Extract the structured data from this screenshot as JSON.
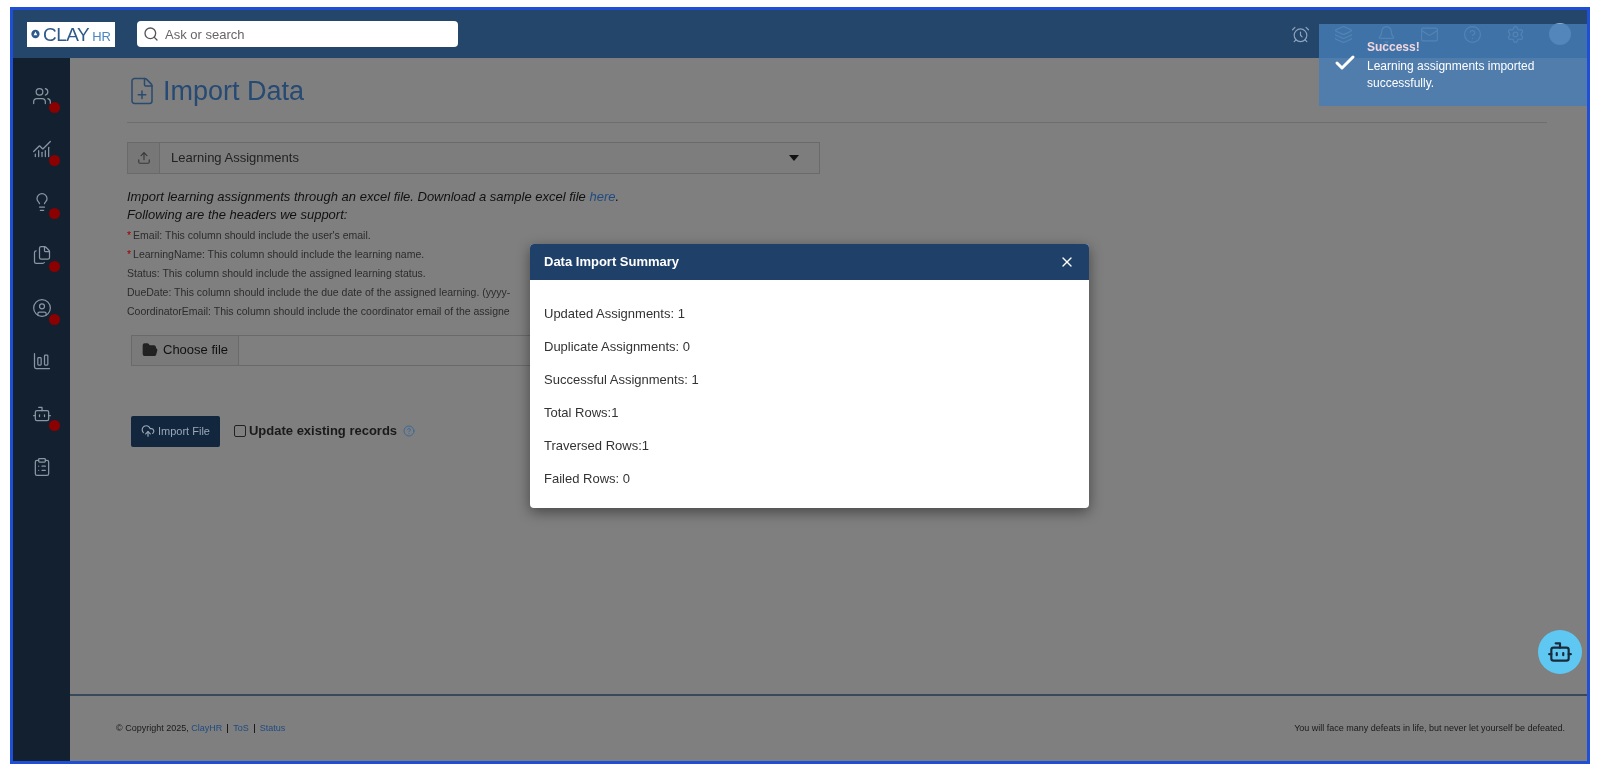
{
  "header": {
    "logo": {
      "main": "CLAY",
      "suffix": "HR"
    },
    "search": {
      "placeholder": "Ask or search"
    },
    "icons": [
      {
        "kind": "alarm"
      },
      {
        "kind": "layers"
      },
      {
        "kind": "bell"
      },
      {
        "kind": "mail"
      },
      {
        "kind": "help"
      },
      {
        "kind": "settings"
      }
    ]
  },
  "sidebar": {
    "items": [
      {
        "kind": "people",
        "alert": true
      },
      {
        "kind": "growth",
        "alert": true
      },
      {
        "kind": "idea",
        "alert": true
      },
      {
        "kind": "documents",
        "alert": true
      },
      {
        "kind": "profile",
        "alert": true
      },
      {
        "kind": "report",
        "alert": false
      },
      {
        "kind": "bot",
        "alert": true
      },
      {
        "kind": "clipboard",
        "alert": false
      }
    ]
  },
  "page": {
    "title": "Import Data",
    "type_select": {
      "value": "Learning Assignments"
    },
    "intro": "Import learning assignments through an excel file. Download a sample excel file ",
    "intro_link": "here",
    "intro_end": ".",
    "headers_title": "Following are the headers we support:",
    "headers": [
      {
        "marker": "*",
        "text": "Email: This column should include the user's email."
      },
      {
        "marker": "*",
        "text": "LearningName: This column should include the learning name."
      },
      {
        "text": "Status: This column should include the assigned learning status."
      },
      {
        "text": "DueDate: This column should include the due date of the assigned learning. (yyyy-"
      },
      {
        "text": "CoordinatorEmail: This column should include the coordinator email of the assigne"
      }
    ],
    "file_button": "Choose file",
    "import_button": "Import File",
    "update_existing": {
      "label": "Update existing records",
      "checked": false
    }
  },
  "modal": {
    "title": "Data Import Summary",
    "lines": [
      "Updated Assignments: 1",
      "Duplicate Assignments: 0",
      "Successful Assignments: 1",
      "Total Rows:1",
      "Traversed Rows:1",
      "Failed Rows: 0"
    ]
  },
  "toast": {
    "title": "Success!",
    "message": "Learning assignments imported successfully."
  },
  "footer": {
    "copyright": "© Copyright 2025, ",
    "company_link": "ClayHR",
    "links": [
      "ToS",
      "Status"
    ],
    "quote": "You will face many defeats in life, but never let yourself be defeated."
  }
}
